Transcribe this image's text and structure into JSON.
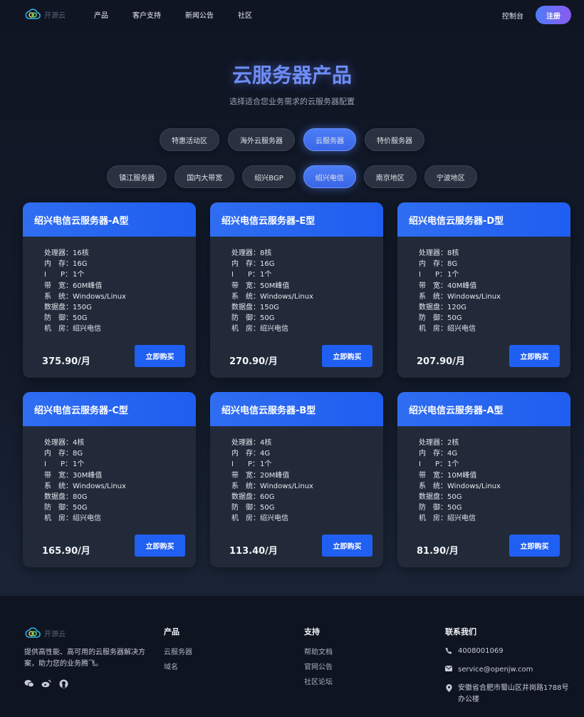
{
  "nav": {
    "brand": "开源云",
    "links": [
      "产品",
      "客户支持",
      "新闻公告",
      "社区"
    ],
    "console": "控制台",
    "register": "注册"
  },
  "hero": {
    "title": "云服务器产品",
    "subtitle": "选择适合您业务需求的云服务器配置"
  },
  "filters_row1": [
    {
      "label": "特惠活动区",
      "active": false
    },
    {
      "label": "海外云服务器",
      "active": false
    },
    {
      "label": "云服务器",
      "active": true
    },
    {
      "label": "特价服务器",
      "active": false
    }
  ],
  "filters_row2": [
    {
      "label": "镇江服务器",
      "active": false
    },
    {
      "label": "国内大带宽",
      "active": false
    },
    {
      "label": "绍兴BGP",
      "active": false
    },
    {
      "label": "绍兴电信",
      "active": true
    },
    {
      "label": "南京地区",
      "active": false
    },
    {
      "label": "宁波地区",
      "active": false
    }
  ],
  "spec_labels": [
    "处理器：",
    "内　存：",
    "I　　P：",
    "带　宽：",
    "系　统：",
    "数据盘：",
    "防　御：",
    "机　房："
  ],
  "buy_label": "立即购买",
  "products": [
    {
      "name": "绍兴电信云服务器-A型",
      "cpu": "16核",
      "ram": "16G",
      "ip": "1个",
      "bw": "60M峰值",
      "os": "Windows/Linux",
      "disk": "150G",
      "ddos": "50G",
      "dc": "绍兴电信",
      "price": "375.90/月"
    },
    {
      "name": "绍兴电信云服务器-E型",
      "cpu": "8核",
      "ram": "16G",
      "ip": "1个",
      "bw": "50M峰值",
      "os": "Windows/Linux",
      "disk": "150G",
      "ddos": "50G",
      "dc": "绍兴电信",
      "price": "270.90/月"
    },
    {
      "name": "绍兴电信云服务器-D型",
      "cpu": "8核",
      "ram": "8G",
      "ip": "1个",
      "bw": "40M峰值",
      "os": "Windows/Linux",
      "disk": "120G",
      "ddos": "50G",
      "dc": "绍兴电信",
      "price": "207.90/月"
    },
    {
      "name": "绍兴电信云服务器-C型",
      "cpu": "4核",
      "ram": "8G",
      "ip": "1个",
      "bw": "30M峰值",
      "os": "Windows/Linux",
      "disk": "80G",
      "ddos": "50G",
      "dc": "绍兴电信",
      "price": "165.90/月"
    },
    {
      "name": "绍兴电信云服务器-B型",
      "cpu": "4核",
      "ram": "4G",
      "ip": "1个",
      "bw": "20M峰值",
      "os": "Windows/Linux",
      "disk": "60G",
      "ddos": "50G",
      "dc": "绍兴电信",
      "price": "113.40/月"
    },
    {
      "name": "绍兴电信云服务器-A型",
      "cpu": "2核",
      "ram": "4G",
      "ip": "1个",
      "bw": "10M峰值",
      "os": "Windows/Linux",
      "disk": "50G",
      "ddos": "50G",
      "dc": "绍兴电信",
      "price": "81.90/月"
    }
  ],
  "footer": {
    "brand": "开源云",
    "desc": "提供高性能、高可用的云服务器解决方案，助力您的业务腾飞。",
    "social_icons": [
      "wechat-icon",
      "weibo-icon",
      "github-icon"
    ],
    "products_title": "产品",
    "products_links": [
      "云服务器",
      "域名"
    ],
    "support_title": "支持",
    "support_links": [
      "帮助文档",
      "官网公告",
      "社区论坛"
    ],
    "contact_title": "联系我们",
    "phone": "4008001069",
    "email": "service@openjw.com",
    "address": "安徽省合肥市蜀山区井岗路1788号办公楼"
  },
  "colors": {
    "accent": "#2f6df1",
    "background": "#131b2b",
    "title": "#6f8df5"
  }
}
